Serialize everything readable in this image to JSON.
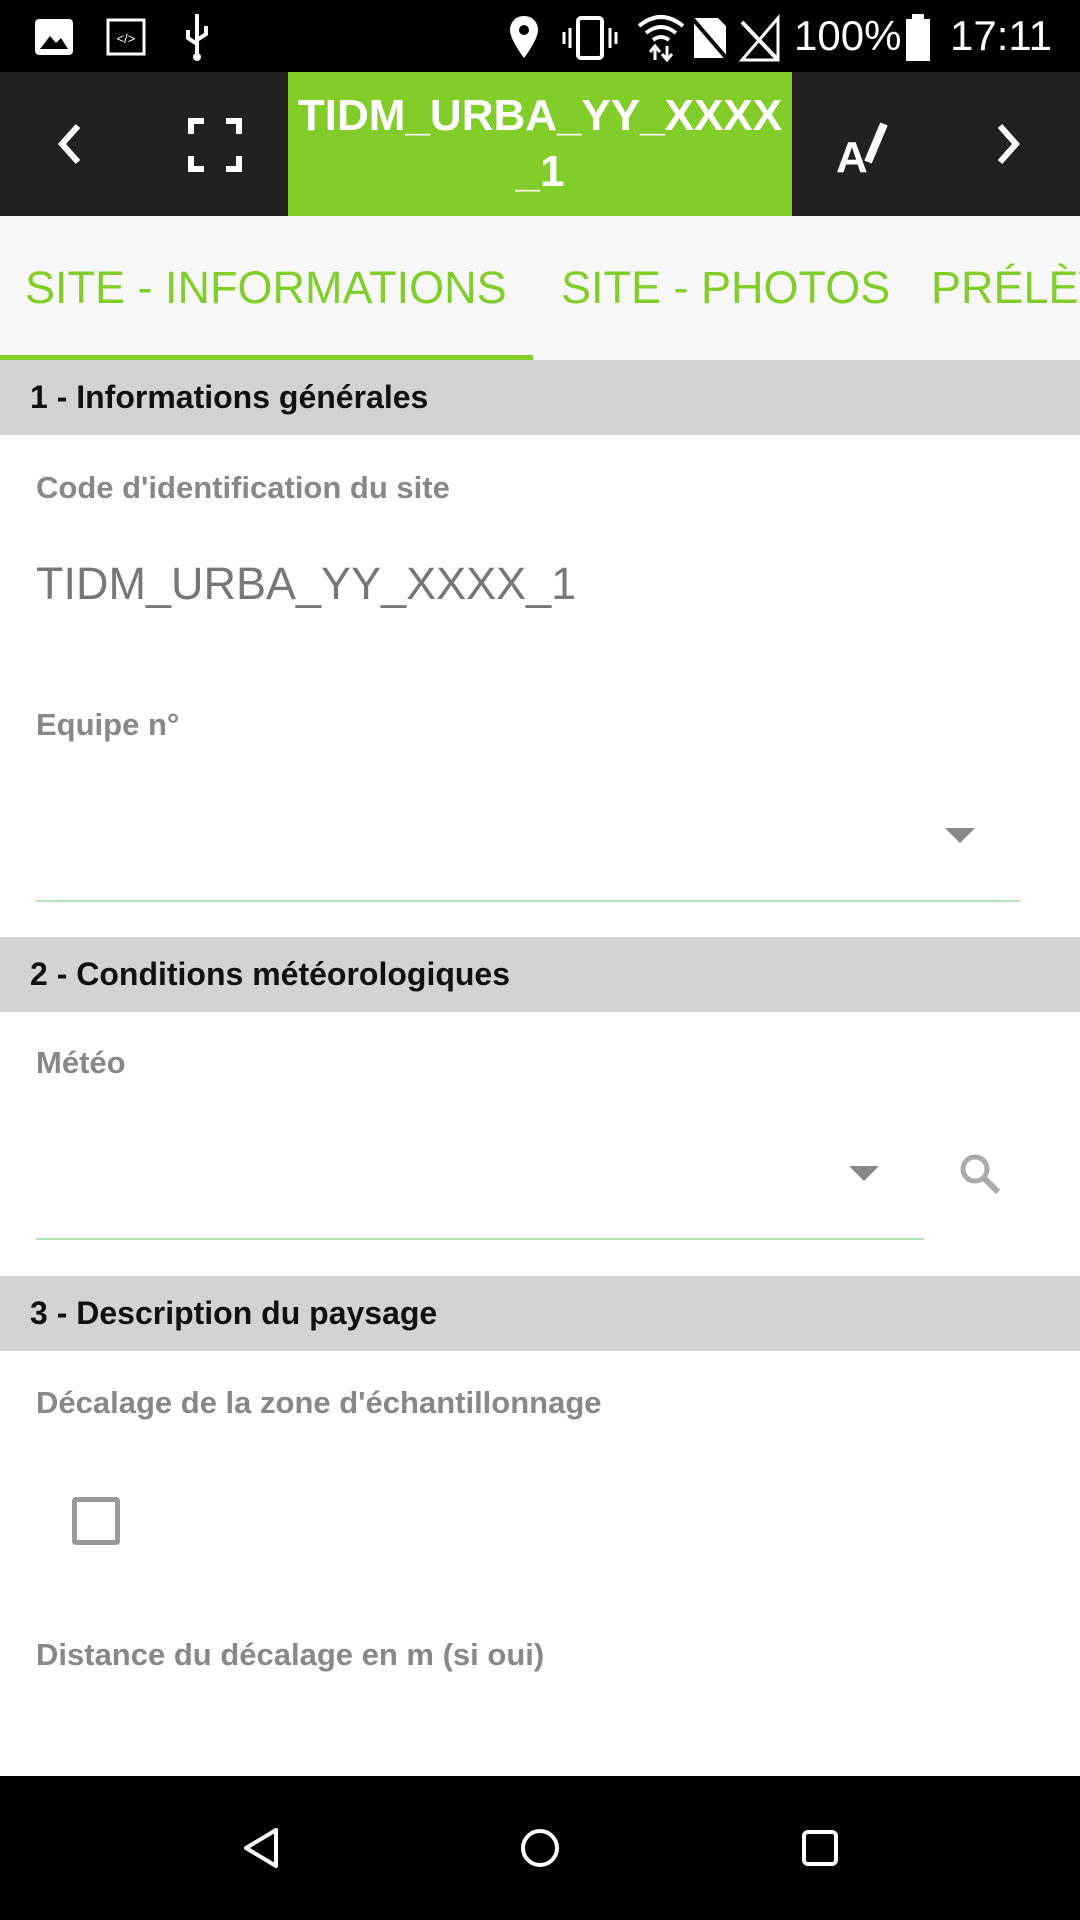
{
  "status_bar": {
    "battery": "100%",
    "time": "17:11",
    "icons": [
      "image-icon",
      "code-icon",
      "usb-icon",
      "location-icon",
      "vibrate-icon",
      "wifi-icon",
      "no-sim-icon",
      "no-signal-icon",
      "battery-icon"
    ]
  },
  "toolbar": {
    "title": "TIDM_URBA_YY_XXXX_1",
    "icons": [
      "back-chevron-icon",
      "fullscreen-icon",
      "edit-text-icon",
      "next-chevron-icon"
    ]
  },
  "tabs": [
    {
      "label": "SITE - INFORMATIONS",
      "active": true
    },
    {
      "label": "SITE - PHOTOS"
    },
    {
      "label": "PRÉLÈVEMENTS"
    }
  ],
  "colors": {
    "accent": "#82cd2a",
    "toolbar": "#212121",
    "section": "#d3d3d3"
  },
  "sections": [
    {
      "title": "1 - Informations générales",
      "fields": [
        {
          "label": "Code d'identification du site",
          "value": "TIDM_URBA_YY_XXXX_1"
        },
        {
          "label": "Equipe n°",
          "value": ""
        }
      ]
    },
    {
      "title": "2 - Conditions météorologiques",
      "fields": [
        {
          "label": "Météo",
          "value": ""
        }
      ]
    },
    {
      "title": "3 - Description du paysage",
      "fields": [
        {
          "label": "Décalage de la zone d'échantillonnage",
          "checked": false
        },
        {
          "label": "Distance du décalage en m (si oui)"
        }
      ]
    }
  ]
}
